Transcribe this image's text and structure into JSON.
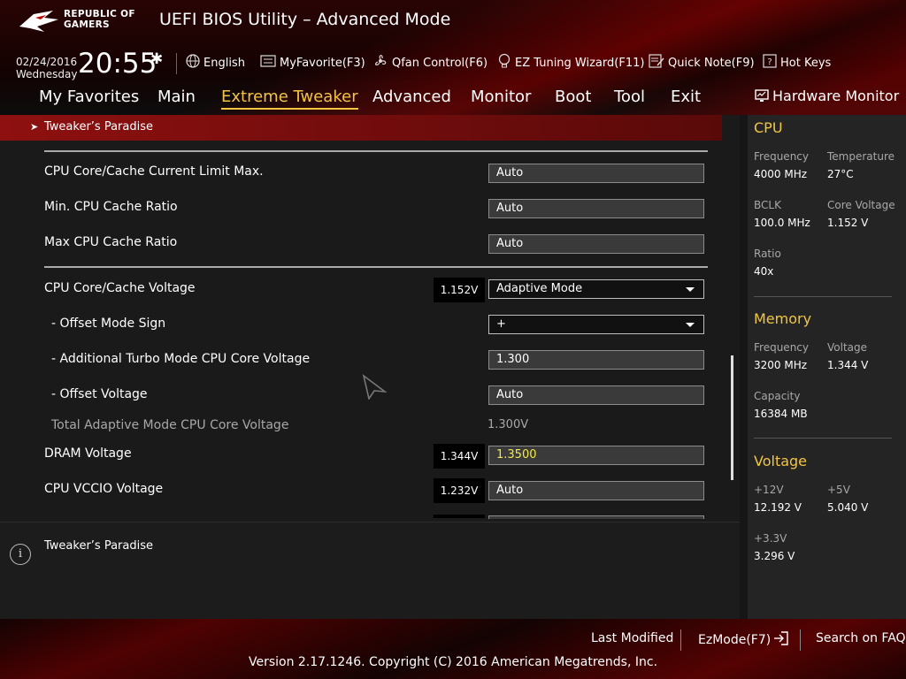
{
  "header": {
    "brand_line1": "REPUBLIC OF",
    "brand_line2": "GAMERS",
    "title": "UEFI BIOS Utility – Advanced Mode",
    "date": "02/24/2016",
    "day": "Wednesday",
    "time": "20:55"
  },
  "utility_bar": {
    "language": "English",
    "my_favorite": "MyFavorite(F3)",
    "qfan": "Qfan Control(F6)",
    "ez_tuning": "EZ Tuning Wizard(F11)",
    "quick_note": "Quick Note(F9)",
    "hot_keys": "Hot Keys"
  },
  "nav": {
    "tabs": [
      "My Favorites",
      "Main",
      "Extreme Tweaker",
      "Advanced",
      "Monitor",
      "Boot",
      "Tool",
      "Exit"
    ],
    "active": "Extreme Tweaker"
  },
  "breadcrumb": "Tweaker’s Paradise",
  "settings": [
    {
      "label": "CPU Core/Cache Current Limit Max.",
      "value": "Auto"
    },
    {
      "label": "Min. CPU Cache Ratio",
      "value": "Auto"
    },
    {
      "label": "Max CPU Cache Ratio",
      "value": "Auto"
    },
    {
      "label": "CPU Core/Cache Voltage",
      "current": "1.152V",
      "value": "Adaptive Mode"
    },
    {
      "label": "- Offset Mode Sign",
      "value": "+"
    },
    {
      "label": "- Additional Turbo Mode CPU Core Voltage",
      "value": "1.300"
    },
    {
      "label": "- Offset Voltage",
      "value": "Auto"
    },
    {
      "label": "Total Adaptive Mode CPU Core Voltage",
      "value": "1.300V"
    },
    {
      "label": "DRAM Voltage",
      "current": "1.344V",
      "value": "1.3500"
    },
    {
      "label": "CPU VCCIO Voltage",
      "current": "1.232V",
      "value": "Auto"
    }
  ],
  "help_text": "Tweaker’s Paradise",
  "hardware_monitor": {
    "title": "Hardware Monitor",
    "cpu": {
      "title": "CPU",
      "frequency_label": "Frequency",
      "frequency": "4000 MHz",
      "temperature_label": "Temperature",
      "temperature": "27°C",
      "bclk_label": "BCLK",
      "bclk": "100.0 MHz",
      "core_voltage_label": "Core Voltage",
      "core_voltage": "1.152 V",
      "ratio_label": "Ratio",
      "ratio": "40x"
    },
    "memory": {
      "title": "Memory",
      "frequency_label": "Frequency",
      "frequency": "3200 MHz",
      "voltage_label": "Voltage",
      "voltage": "1.344 V",
      "capacity_label": "Capacity",
      "capacity": "16384 MB"
    },
    "voltage": {
      "title": "Voltage",
      "v12_label": "+12V",
      "v12": "12.192 V",
      "v5_label": "+5V",
      "v5": "5.040 V",
      "v33_label": "+3.3V",
      "v33": "3.296 V"
    }
  },
  "footer": {
    "last_modified": "Last Modified",
    "ezmode": "EzMode(F7)",
    "search_faq": "Search on FAQ",
    "copyright": "Version 2.17.1246. Copyright (C) 2016 American Megatrends, Inc."
  },
  "colors": {
    "accent": "#f3c542",
    "brand_red": "#8e1010",
    "highlight_value": "#f5e84a"
  }
}
